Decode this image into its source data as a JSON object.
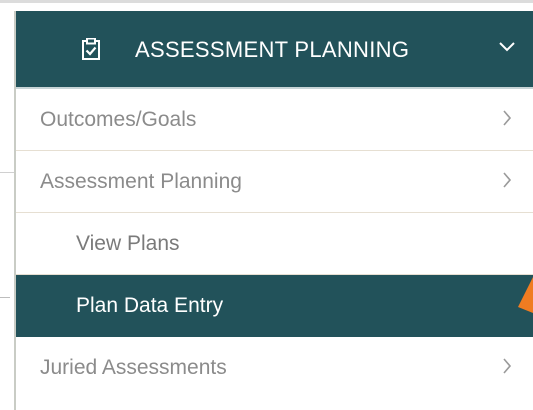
{
  "menu": {
    "header": {
      "title": "ASSESSMENT PLANNING",
      "icon": "clipboard-check-icon",
      "chevron": "chevron-down-icon"
    },
    "items": [
      {
        "label": "Outcomes/Goals",
        "has_chevron": true,
        "chevron": "chevron-right-icon"
      },
      {
        "label": "Assessment Planning",
        "has_chevron": true,
        "chevron": "chevron-right-icon"
      },
      {
        "label": "View Plans",
        "sub": true
      },
      {
        "label": "Plan Data Entry",
        "sub": true,
        "active": true
      },
      {
        "label": "Juried Assessments",
        "has_chevron": true,
        "chevron": "chevron-right-icon"
      }
    ]
  },
  "colors": {
    "header_bg": "#22525a",
    "active_bg": "#22525a",
    "item_text": "#8b8b8b",
    "divider": "#e6dfd2",
    "accent_marker": "#f07c21"
  }
}
